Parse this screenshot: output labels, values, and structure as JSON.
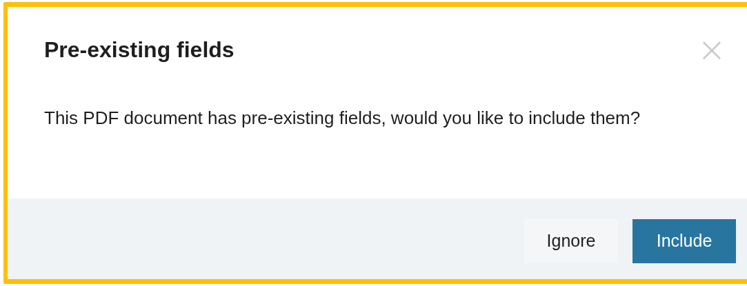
{
  "dialog": {
    "title": "Pre-existing fields",
    "close": "×",
    "message": "This PDF document has pre-existing fields, would you like to include them?"
  },
  "buttons": [
    {
      "label": "Ignore",
      "kind": "secondary"
    },
    {
      "label": "Include",
      "kind": "primary"
    }
  ]
}
